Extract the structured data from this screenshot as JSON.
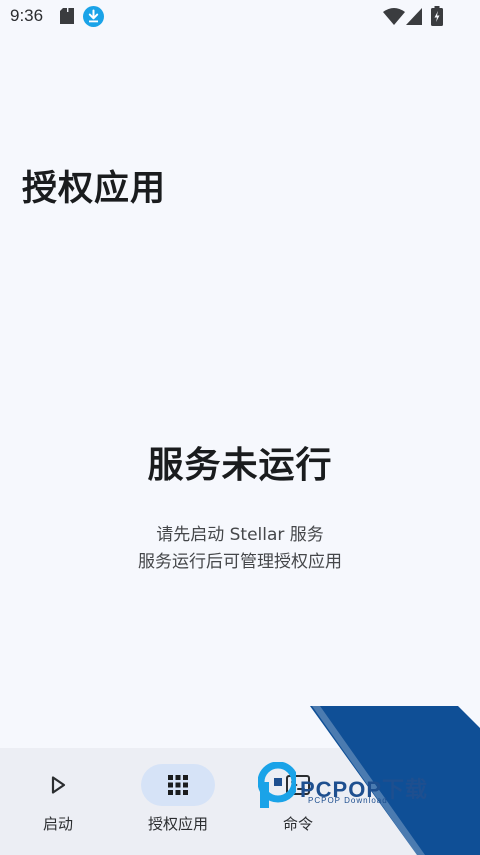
{
  "status_bar": {
    "time": "9:36",
    "icons": [
      "sd-card-icon",
      "download-icon",
      "wifi-icon",
      "signal-icon",
      "battery-icon"
    ]
  },
  "page": {
    "title": "授权应用"
  },
  "empty_state": {
    "title": "服务未运行",
    "line1": "请先启动 Stellar 服务",
    "line2": "服务运行后可管理授权应用"
  },
  "bottom_nav": {
    "items": [
      {
        "label": "启动",
        "icon": "play-icon",
        "active": false
      },
      {
        "label": "授权应用",
        "icon": "grid-icon",
        "active": true
      },
      {
        "label": "命令",
        "icon": "terminal-icon",
        "active": false
      }
    ]
  },
  "watermark": {
    "text": "PCPOP下载",
    "sub": "PCPOP Download"
  },
  "colors": {
    "background": "#f6f8fd",
    "nav_background": "#eceef4",
    "active_indicator": "#d6e3f7",
    "download_badge": "#1aa3e8",
    "watermark_blue": "#0f4f96"
  }
}
